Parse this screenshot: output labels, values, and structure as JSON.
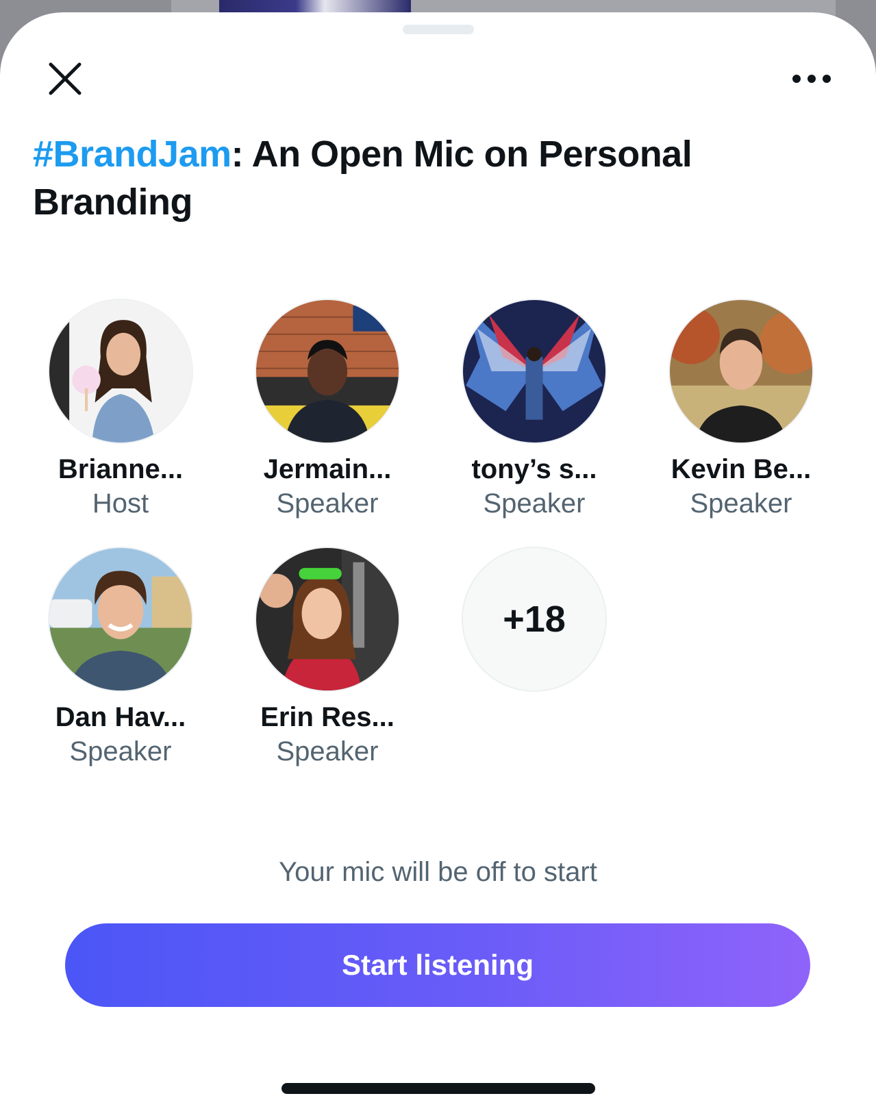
{
  "space": {
    "title_hashtag": "#BrandJam",
    "title_rest": ": An Open Mic on Personal Branding"
  },
  "participants": [
    {
      "name": "Brianne...",
      "role": "Host"
    },
    {
      "name": "Jermain...",
      "role": "Speaker"
    },
    {
      "name": "tony’s s...",
      "role": "Speaker"
    },
    {
      "name": "Kevin Be...",
      "role": "Speaker"
    },
    {
      "name": "Dan Hav...",
      "role": "Speaker"
    },
    {
      "name": "Erin Res...",
      "role": "Speaker"
    }
  ],
  "more_count": "+18",
  "mic_note": "Your mic will be off to start",
  "start_button": "Start listening",
  "icons": {
    "close": "close-icon",
    "more": "more-horizontal-icon"
  },
  "colors": {
    "accent": "#1d9bf0",
    "button_start": "#4b56f6",
    "button_end": "#8f63fa",
    "text": "#0f1419",
    "secondary": "#536471"
  }
}
